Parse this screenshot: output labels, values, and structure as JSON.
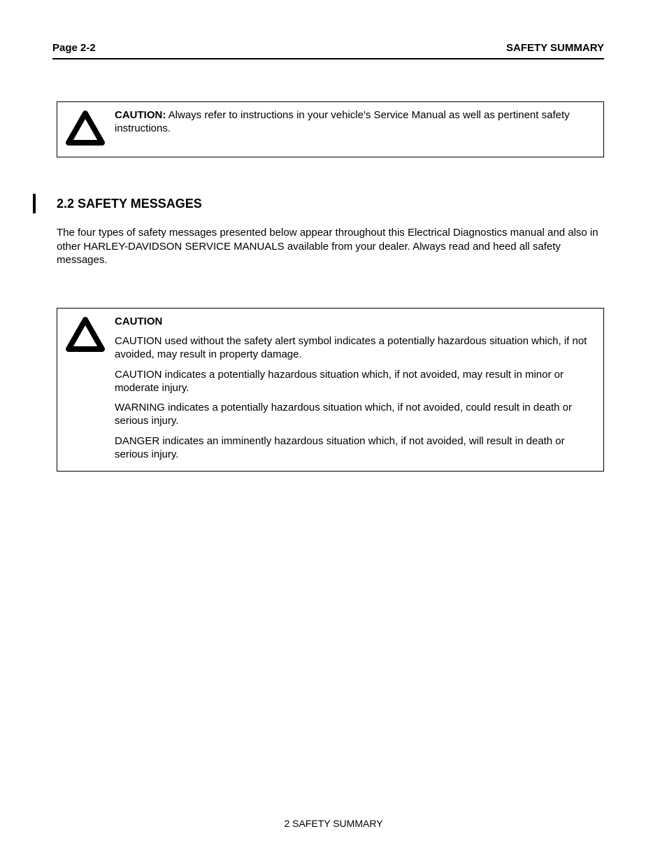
{
  "header": {
    "page_label": "Page 2-2",
    "section_label": "SAFETY SUMMARY"
  },
  "caution1": {
    "label": "CAUTION:",
    "text": "Always refer to instructions in your vehicle's Service Manual as well as pertinent safety instructions."
  },
  "section": {
    "title": "2.2 SAFETY MESSAGES"
  },
  "intro": "The four types of safety messages presented below appear throughout this Electrical Diagnostics manual and also in other HARLEY-DAVIDSON SERVICE MANUALS available from your dealer. Always read and heed all safety messages.",
  "caution2": {
    "label": "CAUTION",
    "p1": "CAUTION used without the safety alert symbol indicates a potentially hazardous situation which, if not avoided, may result in property damage.",
    "p2": "CAUTION indicates a potentially hazardous situation which, if not avoided, may result in minor or moderate injury.",
    "p3": "WARNING indicates a potentially hazardous situation which, if not avoided, could result in death or serious injury.",
    "p4": "DANGER indicates an imminently hazardous situation which, if not avoided, will result in death or serious injury."
  },
  "footer": "2 SAFETY SUMMARY"
}
